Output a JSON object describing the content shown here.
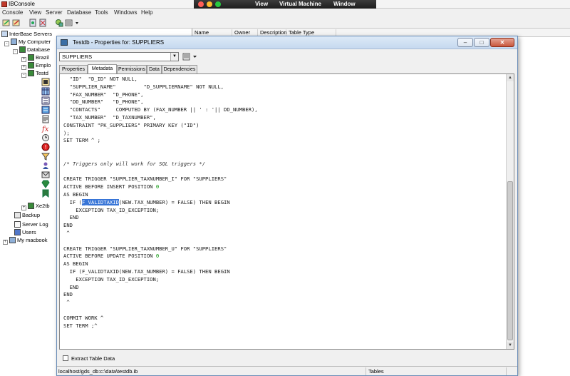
{
  "app": {
    "title": "IBConsole"
  },
  "vm_bar": {
    "menu": [
      "View",
      "Virtual Machine",
      "Window"
    ]
  },
  "menu": [
    "Console",
    "View",
    "Server",
    "Database",
    "Tools",
    "Windows",
    "Help"
  ],
  "tree": {
    "items": [
      "InterBase Servers",
      "My Computer",
      "Database",
      "Brazil",
      "Emplo",
      "Testd",
      "Xe2tb",
      "Backup",
      "Server Log",
      "Users",
      "My macbook"
    ]
  },
  "list": {
    "columns": [
      "Name",
      "Owner",
      "Description",
      "Table Type"
    ]
  },
  "dialog": {
    "title": "Testdb - Properties for: SUPPLIERS",
    "object": "SUPPLIERS",
    "tabs": [
      "Properties",
      "Metadata",
      "Permissions",
      "Data",
      "Dependencies"
    ],
    "active_tab": "Metadata",
    "code": [
      "  \"ID\"  \"D_ID\" NOT NULL,",
      "  \"SUPPLIER_NAME\"         \"D_SUPPLIERNAME\" NOT NULL,",
      "  \"FAX_NUMBER\"  \"D_PHONE\",",
      "  \"DD_NUMBER\"   \"D_PHONE\",",
      "  \"CONTACTS\"     COMPUTED BY (FAX_NUMBER || ' : '|| DD_NUMBER),",
      "  \"TAX_NUMBER\"  \"D_TAXNUMBER\",",
      "CONSTRAINT \"PK_SUPPLIERS\" PRIMARY KEY (\"ID\")",
      ");",
      "SET TERM ^ ;",
      "",
      "",
      "/* Triggers only will work for SQL triggers */",
      "",
      "CREATE TRIGGER \"SUPPLIER_TAXNUMBER_I\" FOR \"SUPPLIERS\"",
      "ACTIVE BEFORE INSERT POSITION 0",
      "AS BEGIN",
      "  IF (F_VALIDTAXID(NEW.TAX_NUMBER) = FALSE) THEN BEGIN",
      "    EXCEPTION TAX_ID_EXCEPTION;",
      "  END",
      "END",
      " ^",
      "",
      "CREATE TRIGGER \"SUPPLIER_TAXNUMBER_U\" FOR \"SUPPLIERS\"",
      "ACTIVE BEFORE UPDATE POSITION 0",
      "AS BEGIN",
      "  IF (F_VALIDTAXID(NEW.TAX_NUMBER) = FALSE) THEN BEGIN",
      "    EXCEPTION TAX_ID_EXCEPTION;",
      "  END",
      "END",
      " ^",
      "",
      "COMMIT WORK ^",
      "SET TERM ;^"
    ],
    "selected_text": "F_VALIDTAXID",
    "extract_label": "Extract Table Data",
    "status_path": "localhost/gds_db:c:\\data\\testdb.ib",
    "status_type": "Tables"
  },
  "colors": {
    "accent": "#3875d7",
    "number": "#009000"
  }
}
